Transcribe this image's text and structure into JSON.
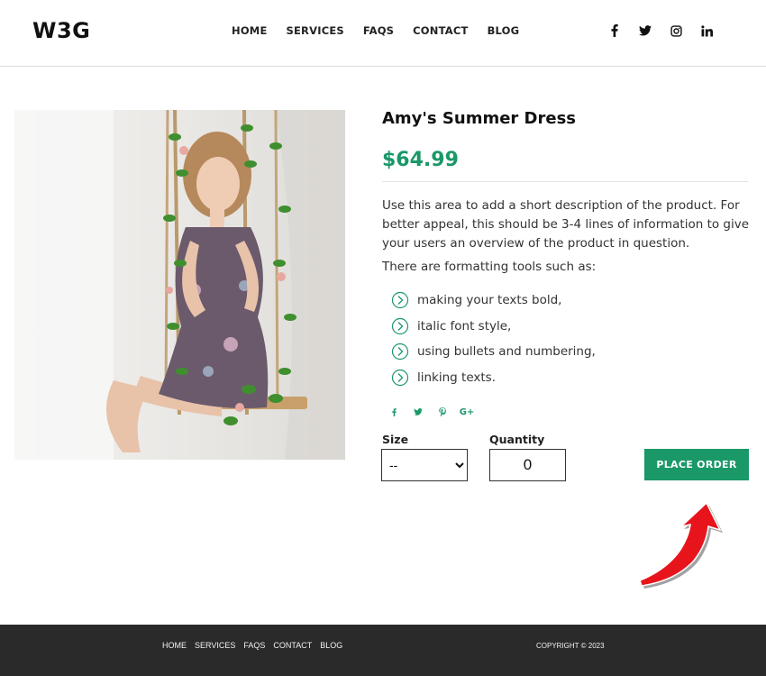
{
  "header": {
    "logo": "W3G",
    "nav": [
      "HOME",
      "SERVICES",
      "FAQS",
      "CONTACT",
      "BLOG"
    ],
    "social_icons": [
      "facebook-icon",
      "twitter-icon",
      "instagram-icon",
      "linkedin-icon"
    ]
  },
  "product": {
    "title": "Amy's Summer Dress",
    "price": "$64.99",
    "description": "Use this area to add a short description of the product. For better appeal, this should be 3-4 lines of information to give your users an overview of the product in question.",
    "formatting_intro": "There are formatting tools such as:",
    "bullets": [
      "making your texts bold,",
      "italic font style,",
      "using bullets and numbering,",
      "linking texts."
    ],
    "share_icons": [
      "facebook-icon",
      "twitter-icon",
      "pinterest-icon",
      "google-plus-icon"
    ],
    "size_label": "Size",
    "size_value": "--",
    "quantity_label": "Quantity",
    "quantity_value": "0",
    "order_button": "PLACE ORDER"
  },
  "footer": {
    "nav": [
      "HOME",
      "SERVICES",
      "FAQS",
      "CONTACT",
      "BLOG"
    ],
    "copyright": "COPYRIGHT © 2023"
  },
  "colors": {
    "accent": "#1a9868",
    "footer_bg": "#2a2a2a",
    "arrow": "#e8141c"
  }
}
